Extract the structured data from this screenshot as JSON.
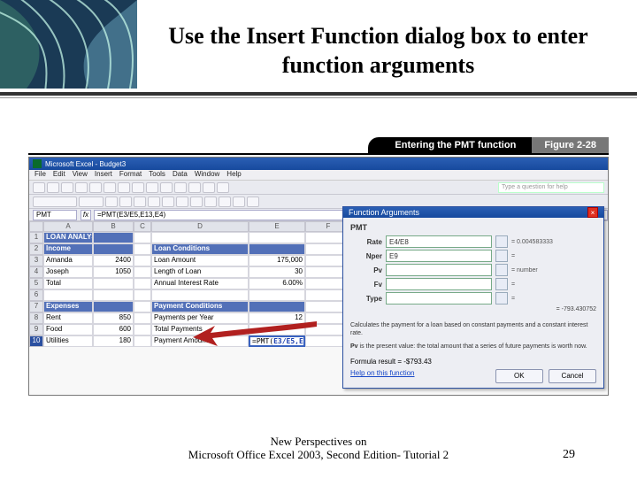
{
  "title": "Use the Insert Function dialog box to enter function arguments",
  "figure": {
    "caption": "Entering the PMT function",
    "label": "Figure 2-28"
  },
  "footer": {
    "left": "New Perspectives on",
    "right": "Microsoft Office Excel 2003, Second Edition- Tutorial 2",
    "page": "29"
  },
  "excel": {
    "title": "Microsoft Excel - Budget3",
    "menu": [
      "File",
      "Edit",
      "View",
      "Insert",
      "Format",
      "Tools",
      "Data",
      "Window",
      "Help"
    ],
    "search_placeholder": "Type a question for help",
    "namebox": "PMT",
    "formula": "=PMT(E3/E5,E13,E4)",
    "columns": [
      "A",
      "B",
      "C",
      "D",
      "E",
      "F"
    ],
    "rows": [
      {
        "a": "LOAN ANALYSIS",
        "hdr": true
      },
      {
        "a": "Income",
        "d": "Loan Conditions",
        "hdrL": true,
        "hdrR": true
      },
      {
        "a": "Amanda",
        "b": "2400",
        "d": "Loan Amount",
        "e": "175,000"
      },
      {
        "a": "Joseph",
        "b": "1050",
        "d": "Length of Loan",
        "e": "30"
      },
      {
        "a": "Total",
        "b": "",
        "d": "Annual Interest Rate",
        "e": "6.00%"
      },
      {
        "a": ""
      },
      {
        "a": "Expenses",
        "d": "Payment Conditions",
        "hdrL": true,
        "hdrR": true
      },
      {
        "a": "Rent",
        "b": "850",
        "d": "Payments per Year",
        "e": "12"
      },
      {
        "a": "Food",
        "b": "600",
        "d": "Total Payments",
        "e": ""
      },
      {
        "a": "Utilities",
        "b": "180",
        "d": "Payment Amount",
        "e_formula": true
      }
    ],
    "editing_formula": {
      "fn": "=PMT(",
      "args": "E3/E5,E13,E4",
      ")": ")"
    }
  },
  "dialog": {
    "title": "Function Arguments",
    "close": "×",
    "fn": "PMT",
    "args": [
      {
        "label": "Rate",
        "value": "E4/E8",
        "eval": "= 0.004583333"
      },
      {
        "label": "Nper",
        "value": "E9",
        "eval": "="
      },
      {
        "label": "Pv",
        "value": "",
        "eval": "= number"
      },
      {
        "label": "Fv",
        "value": "",
        "eval": "="
      },
      {
        "label": "Type",
        "value": "",
        "eval": "="
      }
    ],
    "result_inline": "= -793.430752",
    "desc1": "Calculates the payment for a loan based on constant payments and a constant interest rate.",
    "desc2_label": "Pv",
    "desc2": "is the present value: the total amount that a series of future payments is worth now.",
    "formula_result_label": "Formula result =",
    "formula_result": "-$793.43",
    "help": "Help on this function",
    "ok": "OK",
    "cancel": "Cancel"
  }
}
